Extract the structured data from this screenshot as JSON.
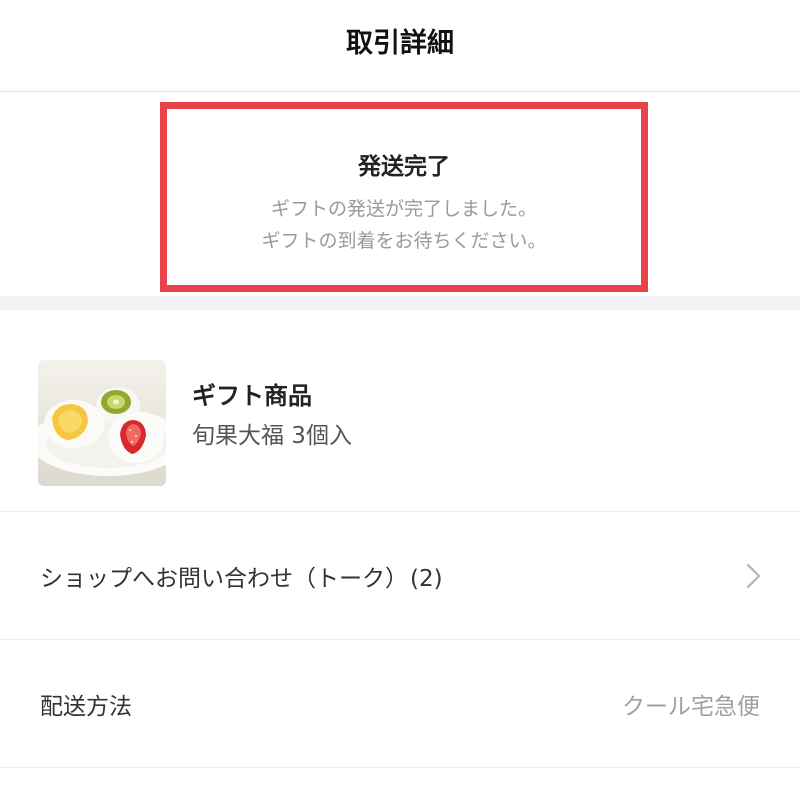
{
  "header": {
    "title": "取引詳細"
  },
  "status": {
    "title": "発送完了",
    "line1": "ギフトの発送が完了しました。",
    "line2": "ギフトの到着をお待ちください。",
    "highlight_color": "#e8434b"
  },
  "product": {
    "label": "ギフト商品",
    "name": "旬果大福 3個入",
    "image_icon": "fruit-daifuku-photo"
  },
  "talk": {
    "label": "ショップへお問い合わせ（トーク）",
    "count": "(2)",
    "icon": "chevron-right-icon"
  },
  "shipping": {
    "label": "配送方法",
    "value": "クール宅急便"
  }
}
